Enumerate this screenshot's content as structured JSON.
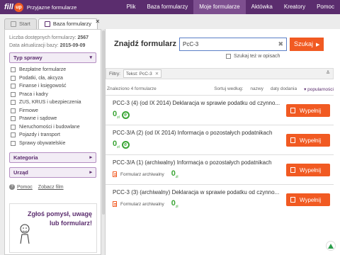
{
  "app": {
    "logo_text": "fill",
    "logo_badge": "up",
    "tagline": "Przyjazne formularze"
  },
  "nav": [
    {
      "label": "Plik",
      "active": false
    },
    {
      "label": "Baza formularzy",
      "active": false
    },
    {
      "label": "Moje formularze",
      "active": true
    },
    {
      "label": "Aktówka",
      "active": false
    },
    {
      "label": "Kreatory",
      "active": false
    },
    {
      "label": "Pomoc",
      "active": false
    }
  ],
  "tabs": [
    {
      "label": "Start"
    },
    {
      "label": "Baza formularzy"
    }
  ],
  "sidebar": {
    "available_label": "Liczba dostępnych formularzy:",
    "available_value": "2567",
    "updated_label": "Data aktualizacji bazy:",
    "updated_value": "2015-09-09",
    "type_heading": "Typ sprawy",
    "types": [
      "Bezpłatne formularze",
      "Podatki, cła, akcyza",
      "Finanse i księgowość",
      "Praca i kadry",
      "ZUS, KRUS i ubezpieczenia",
      "Firmowe",
      "Prawne i sądowe",
      "Nieruchomości i budowlane",
      "Pojazdy i transport",
      "Sprawy obywatelskie"
    ],
    "category_heading": "Kategoria",
    "office_heading": "Urząd",
    "help_link": "Pomoc",
    "video_link": "Zobacz film",
    "promo_line1": "Zgłoś pomysł, uwagę",
    "promo_line2": "lub formularz!"
  },
  "search": {
    "title": "Znajdź formularz",
    "value": "PcC-3",
    "button": "Szukaj",
    "option_label": "Szukaj też w opisach"
  },
  "filters": {
    "label": "Filtry:",
    "chip": "Tekst: PcC-3"
  },
  "results": {
    "count": "Znaleziono 4 formularze",
    "sort_label": "Sortuj według:",
    "sort_options": [
      "nazwy",
      "daty dodania",
      "▾ popularności"
    ]
  },
  "rows": [
    {
      "title": "PCC-3 (4) (od IX 2014) Deklaracja w sprawie podatku od czynno...",
      "archival": false,
      "count": "0",
      "count_sub": "zł",
      "button": "Wypełnij"
    },
    {
      "title": "PCC-3/A (2) (od IX 2014) Informacja o pozostałych podatnikach",
      "archival": false,
      "count": "0",
      "count_sub": "zł",
      "button": "Wypełnij"
    },
    {
      "title": "PCC-3/A (1) (archiwalny) Informacja o pozostałych podatnikach",
      "archival": true,
      "archival_label": "Formularz archiwalny",
      "count": "0",
      "count_sub": "zł",
      "button": "Wypełnij"
    },
    {
      "title": "PCC-3 (3) (archiwalny) Deklaracja w sprawie podatku od czynno...",
      "archival": true,
      "archival_label": "Formularz archiwalny",
      "count": "0",
      "count_sub": "zł",
      "button": "Wypełnij"
    }
  ],
  "colors": {
    "brand": "#5b2d6e",
    "accent": "#f15a22",
    "green": "#3aa535"
  }
}
